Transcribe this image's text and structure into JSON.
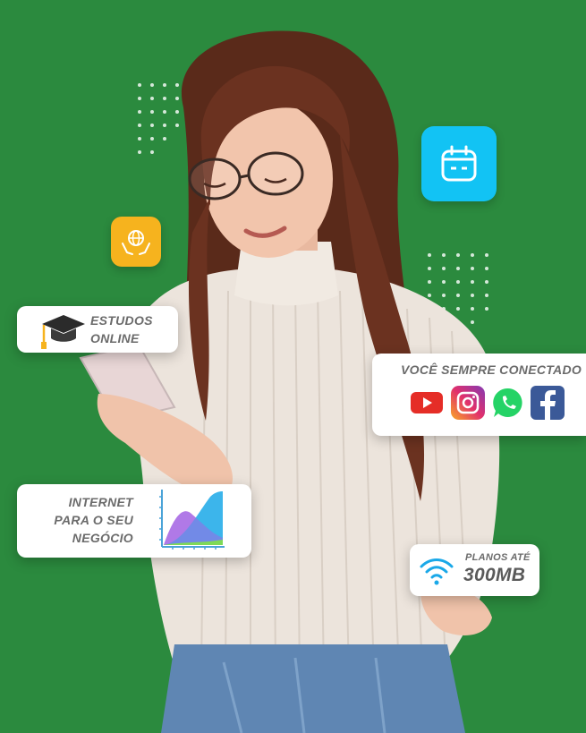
{
  "colors": {
    "background": "#2b8a3e",
    "calendar_badge": "#12c3f4",
    "globe_badge": "#f6b31e",
    "card_text": "#6b6b6b",
    "wifi": "#1aa8e8"
  },
  "cards": {
    "estudos": {
      "line1": "ESTUDOS",
      "line2": "ONLINE"
    },
    "conectado": {
      "title": "VOCÊ SEMPRE CONECTADO"
    },
    "negocio": {
      "line1": "INTERNET",
      "line2": "PARA O SEU",
      "line3": "NEGÓCIO"
    },
    "planos": {
      "small": "PLANOS ATÉ",
      "big": "300MB"
    }
  },
  "icons": {
    "calendar": "calendar-icon",
    "globe_hands": "globe-hands-icon",
    "graduation": "graduation-cap-icon",
    "social": [
      "youtube-icon",
      "instagram-icon",
      "whatsapp-icon",
      "facebook-icon"
    ],
    "chart": "area-chart-icon",
    "wifi": "wifi-icon"
  }
}
